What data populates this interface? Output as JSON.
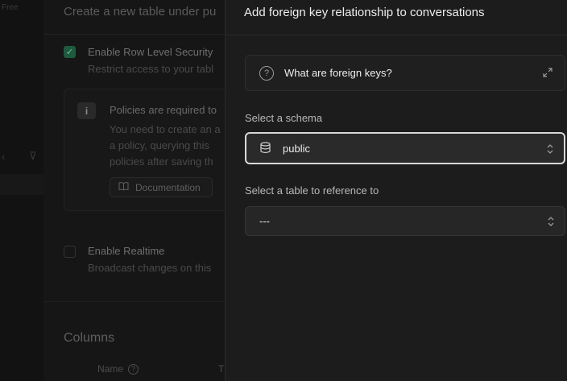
{
  "background": {
    "corner_text": "Free",
    "title": "Create a new table under pu",
    "rls": {
      "label": "Enable Row Level Security",
      "description": "Restrict access to your tabl"
    },
    "callout": {
      "title": "Policies are required to",
      "lines": [
        "You need to create an a",
        "a policy, querying this",
        "policies after saving th"
      ],
      "doc_button": "Documentation"
    },
    "realtime": {
      "label": "Enable Realtime",
      "description": "Broadcast changes on this"
    },
    "columns_heading": "Columns",
    "columns_header": {
      "name": "Name",
      "type_partial": "T"
    }
  },
  "panel": {
    "title": "Add foreign key relationship to conversations",
    "faq_label": "What are foreign keys?",
    "schema": {
      "label": "Select a schema",
      "value": "public"
    },
    "table": {
      "label": "Select a table to reference to",
      "value": "---"
    }
  },
  "colors": {
    "background": "#111111",
    "panel": "#1c1c1c",
    "accent_green": "#1e5a3e"
  }
}
